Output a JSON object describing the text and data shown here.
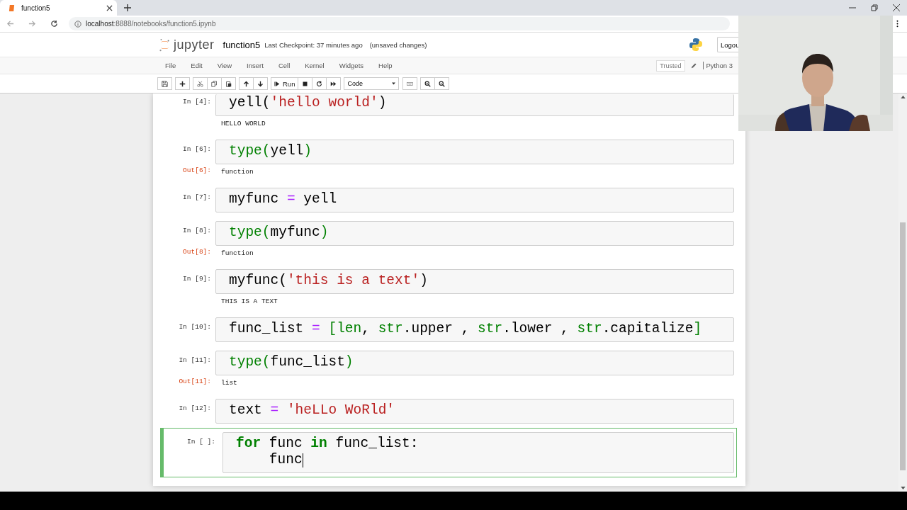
{
  "browser": {
    "tab_title": "function5",
    "url_host": "localhost",
    "url_path": ":8888/notebooks/function5.ipynb"
  },
  "header": {
    "logo_text": "jupyter",
    "notebook_name": "function5",
    "checkpoint": "Last Checkpoint: 37 minutes ago",
    "unsaved": "(unsaved changes)",
    "logout": "Logou"
  },
  "menu": [
    "File",
    "Edit",
    "View",
    "Insert",
    "Cell",
    "Kernel",
    "Widgets",
    "Help"
  ],
  "status": {
    "trusted": "Trusted",
    "kernel": "Python 3"
  },
  "toolbar": {
    "run_label": "Run",
    "cell_type": "Code"
  },
  "cells": [
    {
      "prompt": "In [4]:",
      "selected": false,
      "cursor": false,
      "lines": [
        [
          {
            "kind": "plain",
            "text": "yell("
          },
          {
            "kind": "string",
            "text": "'hello world'"
          },
          {
            "kind": "plain",
            "text": ")"
          }
        ]
      ],
      "output": {
        "text": "HELLO WORLD"
      }
    },
    {
      "prompt": "In [6]:",
      "selected": false,
      "cursor": false,
      "lines": [
        [
          {
            "kind": "builtin",
            "text": "type("
          },
          {
            "kind": "plain",
            "text": "yell"
          },
          {
            "kind": "builtin",
            "text": ")"
          }
        ]
      ],
      "output": {
        "prompt": "Out[6]:",
        "text": "function"
      }
    },
    {
      "prompt": "In [7]:",
      "selected": false,
      "cursor": false,
      "lines": [
        [
          {
            "kind": "plain",
            "text": "myfunc "
          },
          {
            "kind": "operator",
            "text": "="
          },
          {
            "kind": "plain",
            "text": " yell"
          }
        ]
      ]
    },
    {
      "prompt": "In [8]:",
      "selected": false,
      "cursor": false,
      "lines": [
        [
          {
            "kind": "builtin",
            "text": "type("
          },
          {
            "kind": "plain",
            "text": "myfunc"
          },
          {
            "kind": "builtin",
            "text": ")"
          }
        ]
      ],
      "output": {
        "prompt": "Out[8]:",
        "text": "function"
      }
    },
    {
      "prompt": "In [9]:",
      "selected": false,
      "cursor": false,
      "lines": [
        [
          {
            "kind": "plain",
            "text": "myfunc("
          },
          {
            "kind": "string",
            "text": "'this is a text'"
          },
          {
            "kind": "plain",
            "text": ")"
          }
        ]
      ],
      "output": {
        "text": "THIS IS A TEXT"
      }
    },
    {
      "prompt": "In [10]:",
      "selected": false,
      "cursor": false,
      "lines": [
        [
          {
            "kind": "plain",
            "text": "func_list "
          },
          {
            "kind": "operator",
            "text": "= "
          },
          {
            "kind": "builtin",
            "text": "["
          },
          {
            "kind": "builtin",
            "text": "len"
          },
          {
            "kind": "plain",
            "text": ", "
          },
          {
            "kind": "builtin",
            "text": "str"
          },
          {
            "kind": "plain",
            "text": ".upper , "
          },
          {
            "kind": "builtin",
            "text": "str"
          },
          {
            "kind": "plain",
            "text": ".lower , "
          },
          {
            "kind": "builtin",
            "text": "str"
          },
          {
            "kind": "plain",
            "text": ".capitalize"
          },
          {
            "kind": "builtin",
            "text": "]"
          }
        ]
      ]
    },
    {
      "prompt": "In [11]:",
      "selected": false,
      "cursor": false,
      "lines": [
        [
          {
            "kind": "builtin",
            "text": "type("
          },
          {
            "kind": "plain",
            "text": "func_list"
          },
          {
            "kind": "builtin",
            "text": ")"
          }
        ]
      ],
      "output": {
        "prompt": "Out[11]:",
        "text": "list"
      }
    },
    {
      "prompt": "In [12]:",
      "selected": false,
      "cursor": false,
      "lines": [
        [
          {
            "kind": "plain",
            "text": "text "
          },
          {
            "kind": "operator",
            "text": "= "
          },
          {
            "kind": "string",
            "text": "'heLLo WoRld'"
          }
        ]
      ]
    },
    {
      "prompt": "In [ ]:",
      "selected": true,
      "cursor": true,
      "lines": [
        [
          {
            "kind": "keyword",
            "text": "for"
          },
          {
            "kind": "plain",
            "text": " func "
          },
          {
            "kind": "keyword",
            "text": "in"
          },
          {
            "kind": "plain",
            "text": " func_list:"
          }
        ],
        [
          {
            "kind": "plain",
            "text": "    func"
          }
        ]
      ]
    }
  ]
}
